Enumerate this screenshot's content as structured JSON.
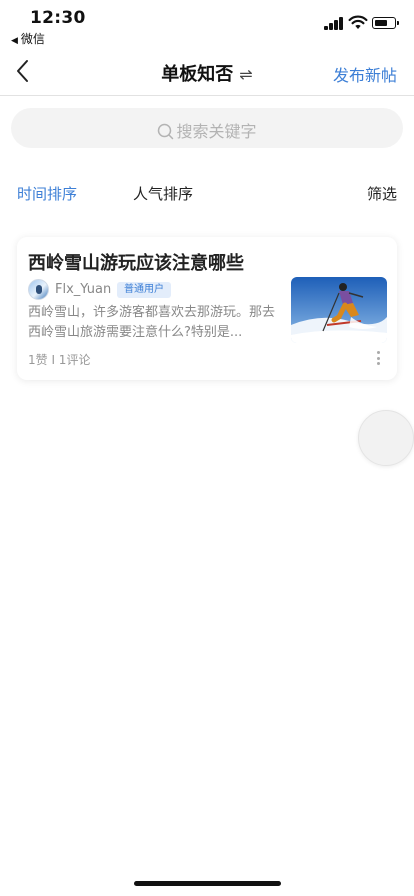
{
  "status_bar": {
    "time": "12:30",
    "back_app": "微信",
    "icons": [
      "signal-icon",
      "wifi-icon",
      "battery-icon"
    ]
  },
  "nav": {
    "title": "单板知否",
    "swap_glyph": "⇌",
    "publish_label": "发布新帖",
    "back_icon": "chevron-left-icon"
  },
  "search": {
    "placeholder": "搜索关键字",
    "icon": "search-icon"
  },
  "sort_tabs": {
    "active": "时间排序",
    "items": [
      "时间排序",
      "人气排序"
    ],
    "filter_label": "筛选"
  },
  "posts": [
    {
      "title": "西岭雪山游玩应该注意哪些",
      "author": "Flx_Yuan",
      "badge": "普通用户",
      "excerpt_line1": "西岭雪山，许多游客都喜欢去那游玩。那去",
      "excerpt_line2": "西岭雪山旅游需要注意什么?特别是...",
      "stats": "1赞 I 1评论"
    }
  ],
  "colors": {
    "accent": "#3d7fd6",
    "muted_text": "#888888",
    "search_bg": "#f3f3f3",
    "badge_bg": "#e3edfb"
  }
}
